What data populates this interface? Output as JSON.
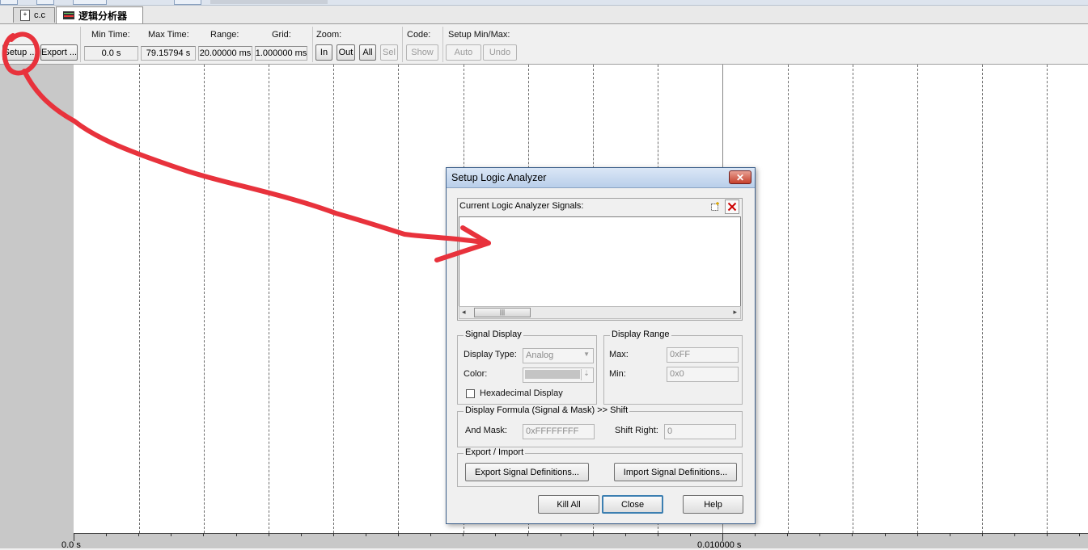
{
  "tabs": [
    {
      "label": "c.c"
    },
    {
      "label": "逻辑分析器"
    }
  ],
  "toolbar": {
    "setup": "Setup ...",
    "export": "Export ...",
    "min_time_label": "Min Time:",
    "min_time_value": "0.0 s",
    "max_time_label": "Max Time:",
    "max_time_value": "79.15794 s",
    "range_label": "Range:",
    "range_value": "20.00000 ms",
    "grid_label": "Grid:",
    "grid_value": "1.000000 ms",
    "zoom_label": "Zoom:",
    "zoom_in": "In",
    "zoom_out": "Out",
    "zoom_all": "All",
    "zoom_sel": "Sel",
    "code_label": "Code:",
    "code_show": "Show",
    "minmax_label": "Setup Min/Max:",
    "auto": "Auto",
    "undo": "Undo"
  },
  "axis": {
    "left_label": "0.0 s",
    "right_label": "0.010000 s"
  },
  "dialog": {
    "title": "Setup Logic Analyzer",
    "signals_label": "Current Logic Analyzer Signals:",
    "signal_display_legend": "Signal Display",
    "display_type_label": "Display Type:",
    "display_type_value": "Analog",
    "color_label": "Color:",
    "hex_label": "Hexadecimal Display",
    "display_range_legend": "Display Range",
    "max_label": "Max:",
    "max_value": "0xFF",
    "min_label": "Min:",
    "min_value": "0x0",
    "formula_legend": "Display Formula (Signal & Mask) >> Shift",
    "and_mask_label": "And Mask:",
    "and_mask_value": "0xFFFFFFFF",
    "shift_right_label": "Shift Right:",
    "shift_right_value": "0",
    "export_import_legend": "Export / Import",
    "export_btn": "Export Signal Definitions...",
    "import_btn": "Import Signal Definitions...",
    "kill_all": "Kill All",
    "close": "Close",
    "help": "Help"
  },
  "colors": {
    "annotation": "#e8323c",
    "plot_background": "#ffffff",
    "dialog_title": "#c9daef"
  }
}
